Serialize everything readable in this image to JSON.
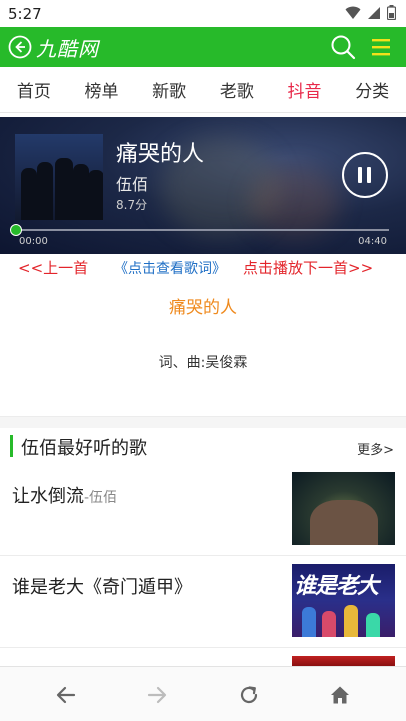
{
  "status": {
    "time": "5:27"
  },
  "header": {
    "logo": "九酷网",
    "accent": "#27ba2a"
  },
  "tabs": [
    {
      "label": "首页"
    },
    {
      "label": "榜单"
    },
    {
      "label": "新歌"
    },
    {
      "label": "老歌"
    },
    {
      "label": "抖音",
      "active": true
    },
    {
      "label": "分类"
    }
  ],
  "player": {
    "title": "痛哭的人",
    "artist": "伍佰",
    "score": "8.7分",
    "time_current": "00:00",
    "time_total": "04:40",
    "progress": 0.0
  },
  "controls": {
    "prev": "<<上一首",
    "lyrics": "《点击查看歌词》",
    "next": "点击播放下一首>>"
  },
  "lyrics": {
    "title": "痛哭的人",
    "credit": "词、曲:吴俊霖"
  },
  "section": {
    "title": "伍佰最好听的歌",
    "more": "更多>"
  },
  "songs": [
    {
      "name": "让水倒流",
      "artist": "-伍佰"
    },
    {
      "name": "谁是老大《奇门遁甲》",
      "artist": ""
    }
  ],
  "thumbs": {
    "thumb2_text": "谁是老大"
  },
  "icons": {
    "back": "back-circle-icon",
    "search": "search-icon",
    "menu": "menu-icon",
    "nav_back": "arrow-left-icon",
    "nav_forward": "arrow-right-icon",
    "refresh": "refresh-icon",
    "home": "home-icon"
  }
}
